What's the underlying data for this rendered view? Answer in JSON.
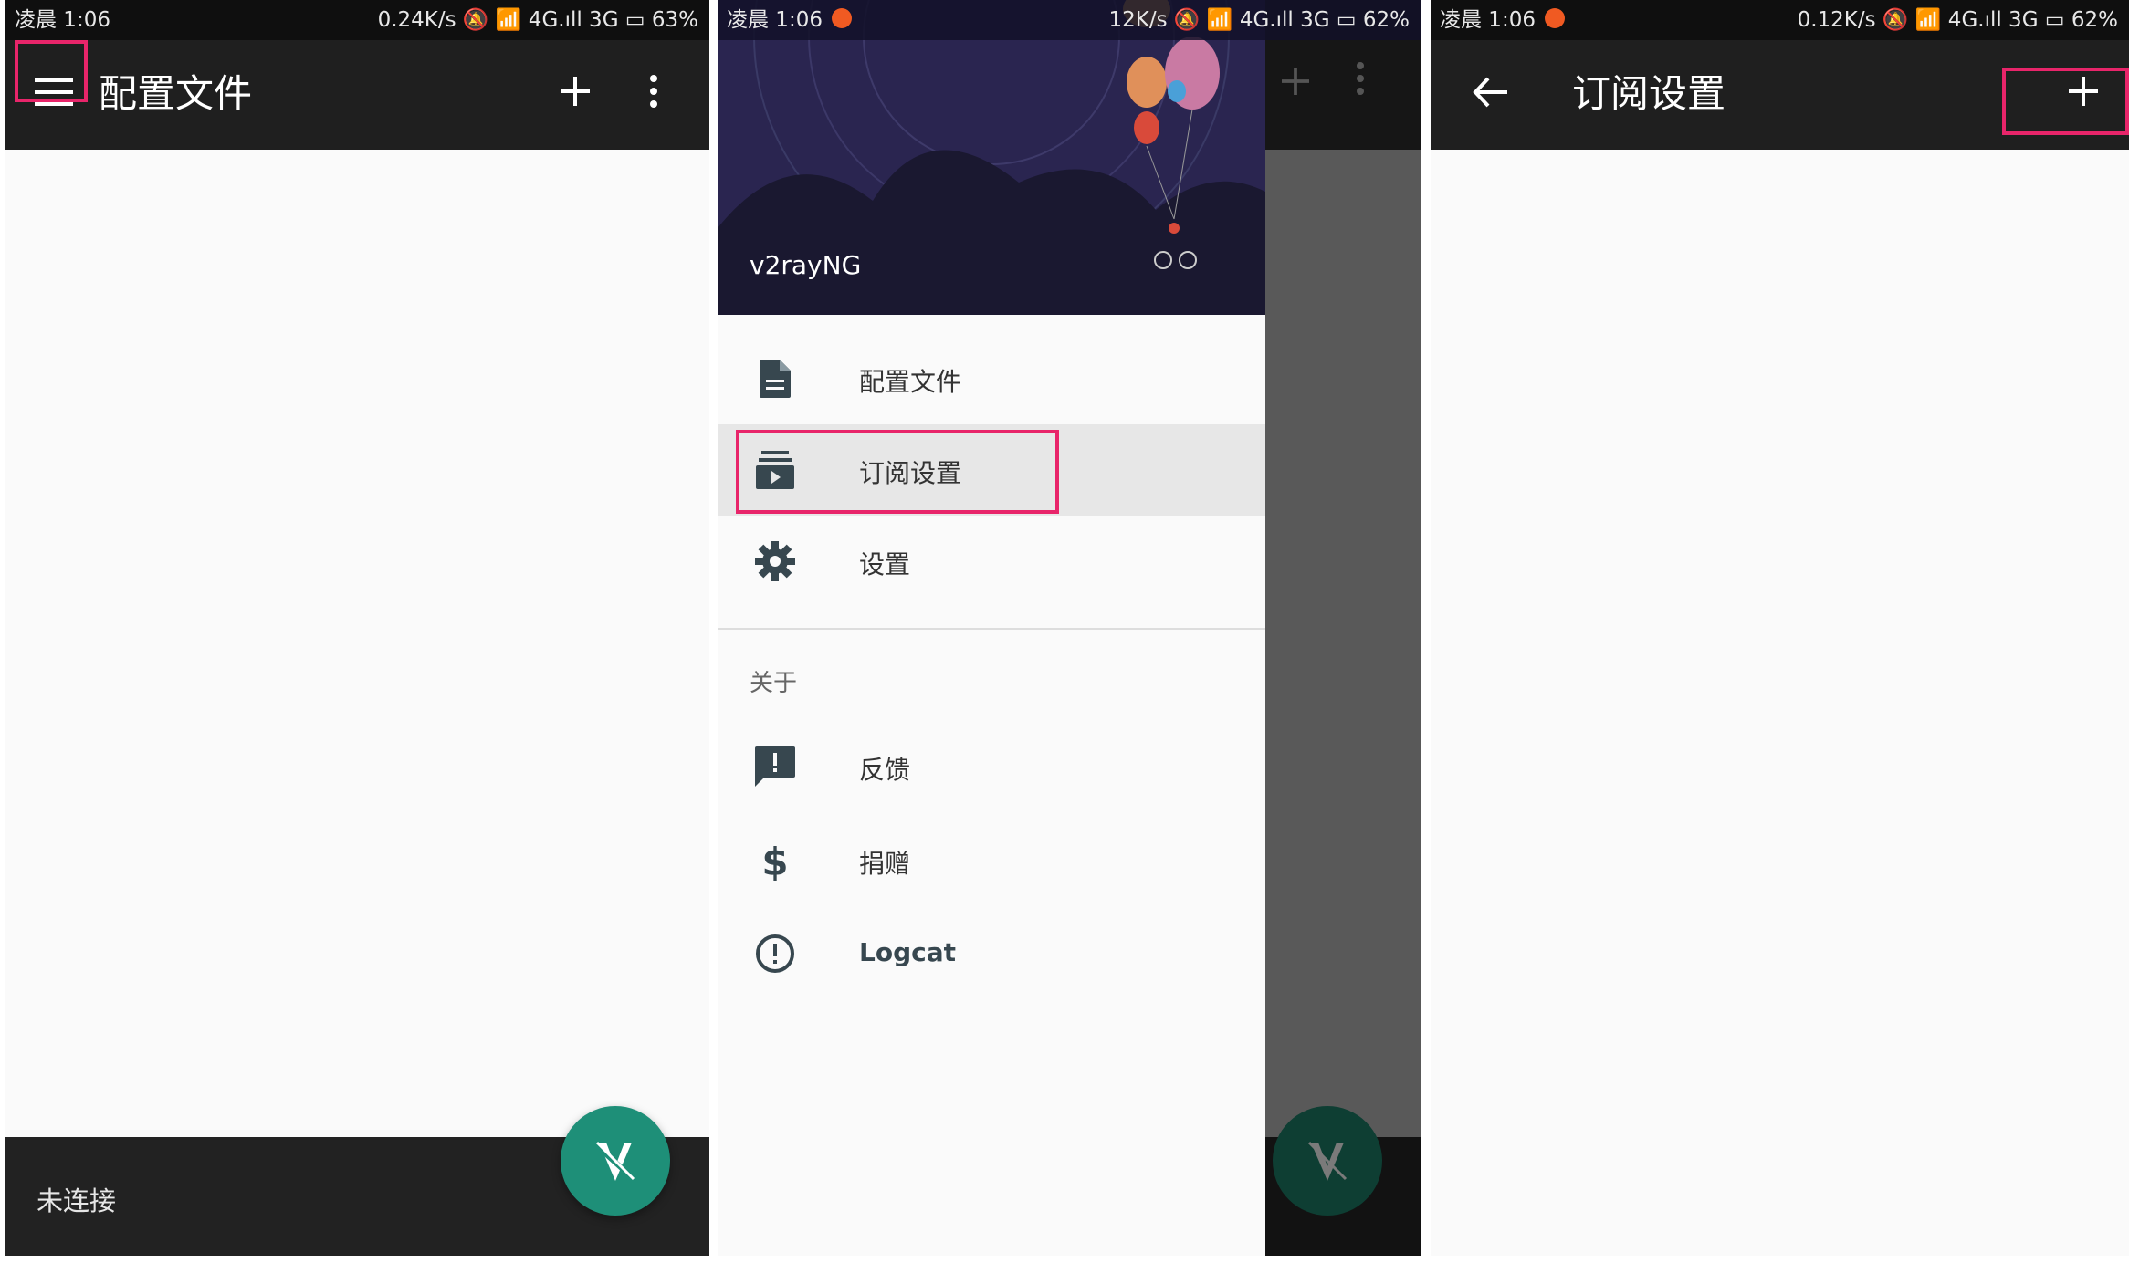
{
  "screen1": {
    "status": {
      "time": "凌晨 1:06",
      "right": "0.24K/s 🔕 📶 4G.ıll 3G ▭ 63%"
    },
    "appbar": {
      "title": "配置文件"
    },
    "bottom": {
      "status": "未连接"
    }
  },
  "screen2": {
    "status": {
      "time": "凌晨 1:06",
      "right": "12K/s 🔕 📶 4G.ıll 3G ▭ 62%"
    },
    "drawer": {
      "app_name": "v2rayNG",
      "items": [
        {
          "label": "配置文件",
          "icon": "file-document-icon"
        },
        {
          "label": "订阅设置",
          "icon": "subscription-icon"
        },
        {
          "label": "设置",
          "icon": "gear-icon"
        }
      ],
      "section": "关于",
      "about_items": [
        {
          "label": "反馈",
          "icon": "feedback-icon"
        },
        {
          "label": "捐赠",
          "icon": "dollar-icon"
        },
        {
          "label": "Logcat",
          "icon": "alert-circle-icon"
        }
      ]
    }
  },
  "screen3": {
    "status": {
      "time": "凌晨 1:06",
      "right": "0.12K/s 🔕 📶 4G.ıll 3G ▭ 62%"
    },
    "appbar": {
      "title": "订阅设置"
    }
  },
  "colors": {
    "highlight": "#e8256a",
    "fab": "#1e8f78",
    "appbar": "#1f1f1f"
  }
}
